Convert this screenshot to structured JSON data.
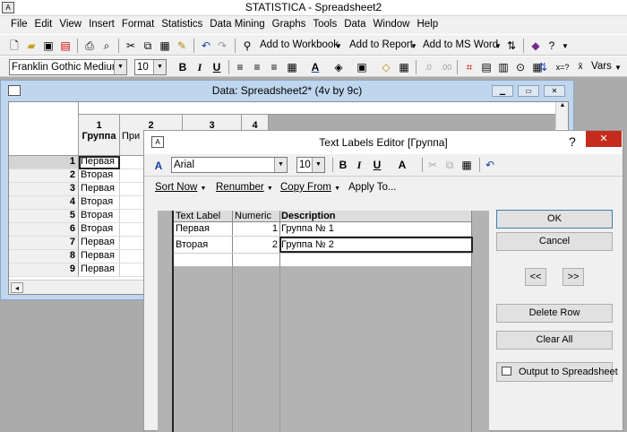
{
  "app_title": "STATISTICA - Spreadsheet2",
  "menu": [
    "File",
    "Edit",
    "View",
    "Insert",
    "Format",
    "Statistics",
    "Data Mining",
    "Graphs",
    "Tools",
    "Data",
    "Window",
    "Help"
  ],
  "toolbar1": {
    "add_to_workbook": "Add to Workbook",
    "add_to_report": "Add to Report",
    "add_to_ms_word": "Add to MS Word"
  },
  "toolbar2": {
    "font": "Franklin Gothic Medium",
    "size": "10",
    "vars": "Vars"
  },
  "spreadsheet": {
    "title": "Data: Spreadsheet2* (4v by 9c)",
    "col1_num": "1",
    "col1_name": "Группа",
    "col2_partial": "При",
    "col_nums": [
      "2",
      "3",
      "4"
    ],
    "rows": [
      [
        "1",
        "Первая"
      ],
      [
        "2",
        "Вторая"
      ],
      [
        "3",
        "Первая"
      ],
      [
        "4",
        "Вторая"
      ],
      [
        "5",
        "Вторая"
      ],
      [
        "6",
        "Вторая"
      ],
      [
        "7",
        "Первая"
      ],
      [
        "8",
        "Первая"
      ],
      [
        "9",
        "Первая"
      ]
    ]
  },
  "dialog": {
    "title": "Text Labels Editor [Группа]",
    "help": "?",
    "close": "✕",
    "font": "Arial",
    "size": "10",
    "menus": [
      "Sort Now",
      "Renumber",
      "Copy From",
      "Apply To..."
    ],
    "columns": [
      "Text Label",
      "Numeric",
      "Description"
    ],
    "rows": [
      {
        "label": "Первая",
        "numeric": "1",
        "desc": "Группа № 1"
      },
      {
        "label": "Вторая",
        "numeric": "2",
        "desc": "Группа № 2"
      }
    ],
    "ok": "OK",
    "cancel": "Cancel",
    "prev": "<<",
    "next": ">>",
    "delete_row": "Delete Row",
    "clear_all": "Clear All",
    "output": "Output to Spreadsheet"
  }
}
